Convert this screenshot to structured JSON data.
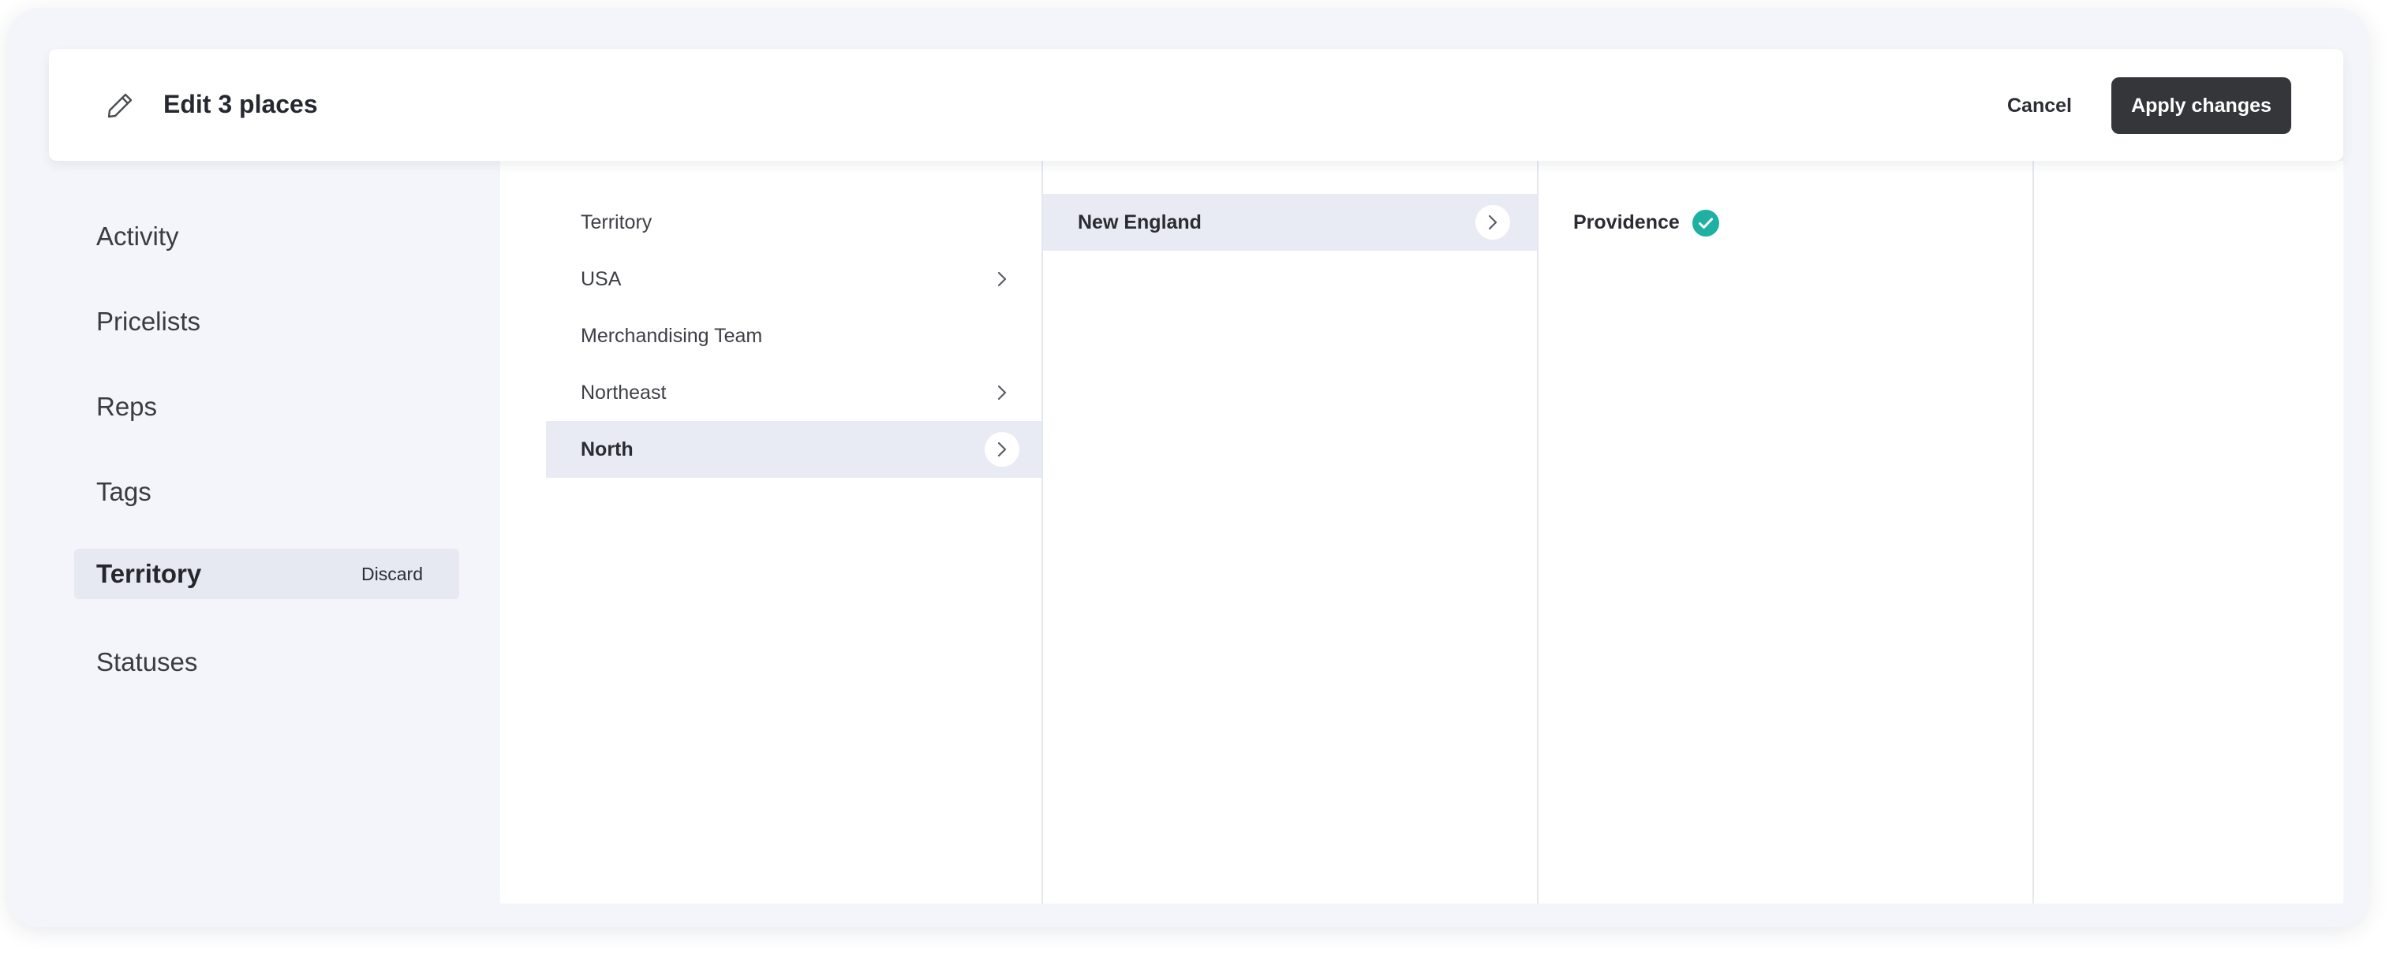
{
  "header": {
    "title": "Edit 3 places",
    "icon": "pencil-icon",
    "cancel_label": "Cancel",
    "apply_label": "Apply changes"
  },
  "sidebar": {
    "items": [
      {
        "label": "Activity"
      },
      {
        "label": "Pricelists"
      },
      {
        "label": "Reps"
      },
      {
        "label": "Tags"
      },
      {
        "label": "Territory",
        "active": true,
        "action_label": "Discard"
      },
      {
        "label": "Statuses"
      }
    ]
  },
  "columns": [
    {
      "items": [
        {
          "label": "Territory",
          "has_children": false
        },
        {
          "label": "USA",
          "has_children": true
        },
        {
          "label": "Merchandising Team",
          "has_children": false
        },
        {
          "label": "Northeast",
          "has_children": true
        },
        {
          "label": "North",
          "has_children": true,
          "selected": true
        }
      ]
    },
    {
      "items": [
        {
          "label": "New England",
          "has_children": true,
          "selected": true
        }
      ]
    },
    {
      "items": [
        {
          "label": "Providence",
          "checked": true
        }
      ]
    },
    {
      "items": []
    }
  ],
  "colors": {
    "accent": "#1eb0a3",
    "primary_button": "#35363a",
    "selected_row": "#e8ebf3",
    "background": "#f4f5fa"
  }
}
